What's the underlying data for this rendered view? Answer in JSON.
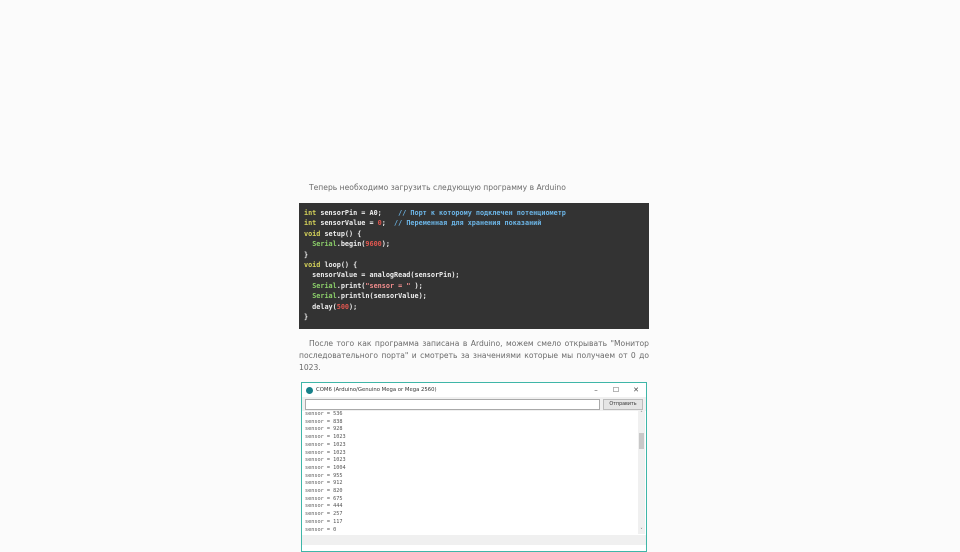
{
  "intro": "Теперь необходимо загрузить следующую программу в Arduino",
  "code": {
    "l1": {
      "kw": "int",
      "t": " sensorPin = A0;    ",
      "c": "// Порт к которому подклечен потенциометр"
    },
    "l2": {
      "kw": "int",
      "t": " sensorValue = ",
      "n": "0",
      "t2": ";  ",
      "c": "// Переменная для хранения показаний"
    },
    "l3": {
      "kw": "void",
      "t": " setup() {"
    },
    "l4": {
      "fn": "Serial",
      "t": ".begin(",
      "n": "9600",
      "t2": ");"
    },
    "l5": "}",
    "l6": {
      "kw": "void",
      "t": " loop() {"
    },
    "l7": "  sensorValue = analogRead(sensorPin);",
    "l8": {
      "fn": "Serial",
      "t": ".print(",
      "s": "\"sensor = \"",
      "t2": " );"
    },
    "l9": {
      "fn": "Serial",
      "t": ".println(sensorValue);"
    },
    "l10": {
      "t": "  delay(",
      "n": "500",
      "t2": ");"
    },
    "l11": "}"
  },
  "para": {
    "l1": "После того как программа записана в Arduino, можем смело открывать \"Монитор",
    "l2": "последовательного порта\" и смотреть за значениями которые мы получаем от 0 до 1023."
  },
  "monitor": {
    "title": "COM6 (Arduino/Genuino Mega or Mega 2560)",
    "min": "–",
    "max": "☐",
    "close": "✕",
    "send": "Отправить",
    "lines": [
      "sensor = 536",
      "sensor = 838",
      "sensor = 928",
      "sensor = 1023",
      "sensor = 1023",
      "sensor = 1023",
      "sensor = 1023",
      "sensor = 1004",
      "sensor = 955",
      "sensor = 912",
      "sensor = 820",
      "sensor = 675",
      "sensor = 444",
      "sensor = 257",
      "sensor = 117",
      "sensor = 0"
    ],
    "scroll_up": "˄",
    "scroll_down": "˅"
  }
}
